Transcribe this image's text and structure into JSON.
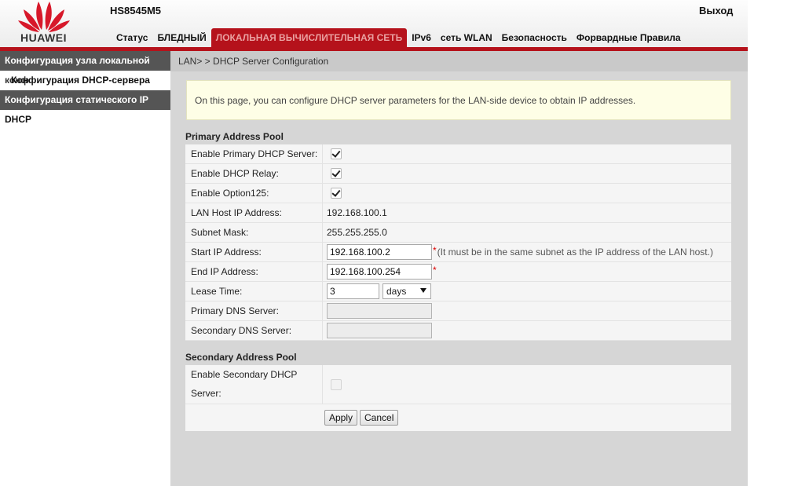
{
  "header": {
    "brand": "HUAWEI",
    "model": "HS8545M5",
    "logout": "Выход",
    "brand_color": "#b5121b",
    "nav": [
      {
        "label": "Статус",
        "active": false
      },
      {
        "label": "БЛЕДНЫЙ",
        "active": false
      },
      {
        "label": "ЛОКАЛЬНАЯ ВЫЧИСЛИТЕЛЬНАЯ СЕТЬ",
        "active": true
      },
      {
        "label": "IPv6",
        "active": false
      },
      {
        "label": "сеть WLAN",
        "active": false
      },
      {
        "label": "Безопасность",
        "active": false
      },
      {
        "label": "Форвардные Правила",
        "active": false
      }
    ]
  },
  "sidebar": {
    "items": [
      {
        "label": "Конфигурация узла локальной",
        "style": "dark"
      },
      {
        "label": "Конфигурация DHCP-сервера",
        "overlay": "конф",
        "style": "light"
      },
      {
        "label": "Конфигурация статического IP",
        "style": "dark"
      },
      {
        "label": "DHCP",
        "style": "light"
      }
    ]
  },
  "main": {
    "breadcrumb": "LAN> > DHCP Server Configuration",
    "info": "On this page, you can configure DHCP server parameters for the LAN-side device to obtain IP addresses.",
    "primary": {
      "title": "Primary Address Pool",
      "enable_primary_label": "Enable Primary DHCP Server:",
      "enable_relay_label": "Enable DHCP Relay:",
      "enable_option125_label": "Enable Option125:",
      "lan_host_ip_label": "LAN Host IP Address:",
      "lan_host_ip_value": "192.168.100.1",
      "subnet_mask_label": "Subnet Mask:",
      "subnet_mask_value": "255.255.255.0",
      "start_ip_label": "Start IP Address:",
      "start_ip_value": "192.168.100.2",
      "start_ip_hint": "(It must be in the same subnet as the IP address of the LAN host.)",
      "end_ip_label": "End IP Address:",
      "end_ip_value": "192.168.100.254",
      "required_mark": "*",
      "lease_time_label": "Lease Time:",
      "lease_time_value": "3",
      "lease_unit": "days",
      "primary_dns_label": "Primary DNS Server:",
      "primary_dns_value": "",
      "secondary_dns_label": "Secondary DNS Server:",
      "secondary_dns_value": ""
    },
    "secondary": {
      "title": "Secondary Address Pool",
      "enable_label": "Enable Secondary DHCP Server:"
    },
    "buttons": {
      "apply": "Apply",
      "cancel": "Cancel"
    }
  }
}
